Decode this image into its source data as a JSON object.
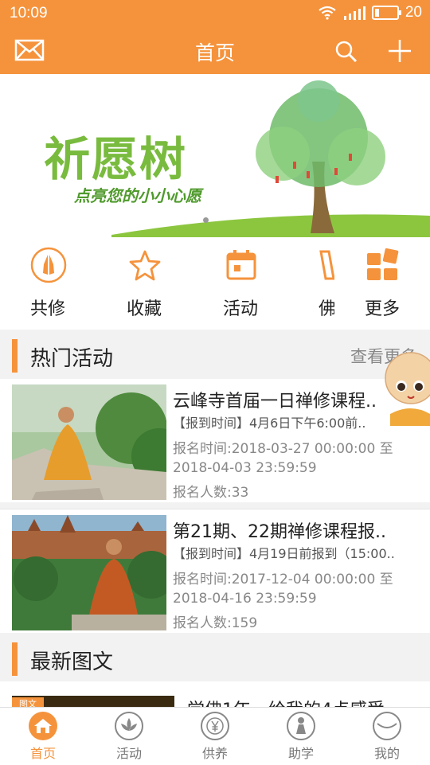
{
  "status": {
    "time": "10:09",
    "battery": "20",
    "battery_level": 0.2
  },
  "header": {
    "title": "首页",
    "icons": [
      "mail-icon",
      "search-icon",
      "plus-icon"
    ]
  },
  "banner": {
    "title": "祈愿树",
    "subtitle": "点亮您的小小心愿"
  },
  "quick_menu": [
    {
      "label": "共修",
      "icon": "prayer-hands-icon"
    },
    {
      "label": "收藏",
      "icon": "star-icon"
    },
    {
      "label": "活动",
      "icon": "calendar-icon"
    },
    {
      "label": "佛",
      "icon": "book-icon"
    },
    {
      "label": "更多",
      "icon": "grid-icon"
    }
  ],
  "hot": {
    "title": "热门活动",
    "more": "查看更多",
    "items": [
      {
        "title": "云峰寺首届一日禅修课程..",
        "checkin": "【报到时间】4月6日下午6:00前..",
        "period": "报名时间:2018-03-27 00:00:00 至 2018-04-03 23:59:59",
        "count": "报名人数:33"
      },
      {
        "title": "第21期、22期禅修课程报..",
        "checkin": "【报到时间】4月19日前报到（15:00..",
        "period": "报名时间:2017-12-04 00:00:00 至 2018-04-16 23:59:59",
        "count": "报名人数:159"
      }
    ]
  },
  "latest": {
    "title": "最新图文",
    "items": [
      {
        "tag": "图文",
        "title": "学佛1年，给我的4点感受"
      }
    ]
  },
  "tabbar": [
    {
      "label": "首页",
      "icon": "home-icon",
      "active": true
    },
    {
      "label": "活动",
      "icon": "lotus-icon",
      "active": false
    },
    {
      "label": "供养",
      "icon": "yen-coin-icon",
      "active": false
    },
    {
      "label": "助学",
      "icon": "person-icon",
      "active": false
    },
    {
      "label": "我的",
      "icon": "profile-icon",
      "active": false
    }
  ],
  "colors": {
    "accent": "#f5933c",
    "banner_green": "#79bb3e"
  }
}
